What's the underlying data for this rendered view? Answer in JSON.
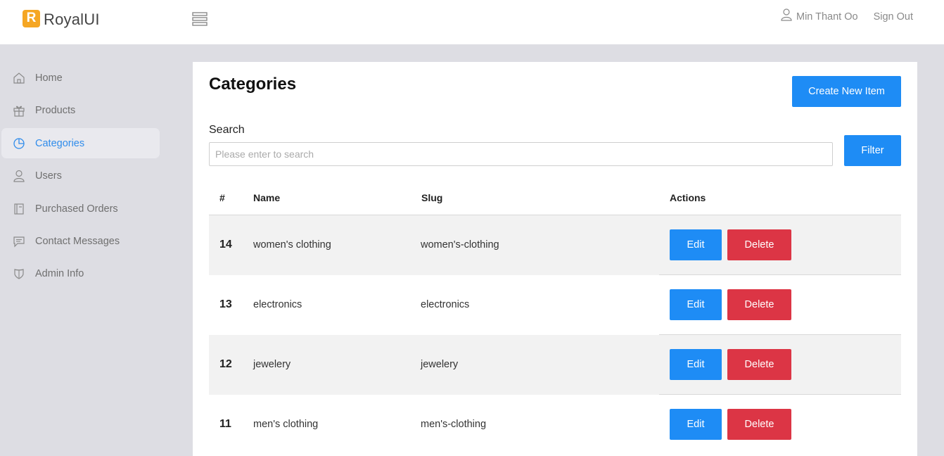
{
  "brand": {
    "logo_letter": "R",
    "name": "RoyalUI",
    "accent": "#f5a623"
  },
  "header": {
    "username": "Min Thant Oo",
    "signout_label": "Sign Out"
  },
  "sidebar": {
    "items": [
      {
        "label": "Home",
        "icon": "home-icon"
      },
      {
        "label": "Products",
        "icon": "gift-icon"
      },
      {
        "label": "Categories",
        "icon": "pie-chart-icon",
        "active": true
      },
      {
        "label": "Users",
        "icon": "user-icon"
      },
      {
        "label": "Purchased Orders",
        "icon": "book-icon"
      },
      {
        "label": "Contact Messages",
        "icon": "message-icon"
      },
      {
        "label": "Admin Info",
        "icon": "shield-icon"
      }
    ]
  },
  "main": {
    "title": "Categories",
    "create_label": "Create New Item",
    "search": {
      "label": "Search",
      "placeholder": "Please enter to search",
      "value": ""
    },
    "filter_label": "Filter",
    "table": {
      "columns": [
        "#",
        "Name",
        "Slug",
        "Actions"
      ],
      "rows": [
        {
          "id": "14",
          "name": "women's clothing",
          "slug": "women's-clothing",
          "edit": "Edit",
          "delete": "Delete"
        },
        {
          "id": "13",
          "name": "electronics",
          "slug": "electronics",
          "edit": "Edit",
          "delete": "Delete"
        },
        {
          "id": "12",
          "name": "jewelery",
          "slug": "jewelery",
          "edit": "Edit",
          "delete": "Delete"
        },
        {
          "id": "11",
          "name": "men's clothing",
          "slug": "men's-clothing",
          "edit": "Edit",
          "delete": "Delete"
        }
      ]
    }
  },
  "colors": {
    "primary": "#1e8cf5",
    "danger": "#dc3545",
    "active_nav": "#2f8ceb"
  }
}
